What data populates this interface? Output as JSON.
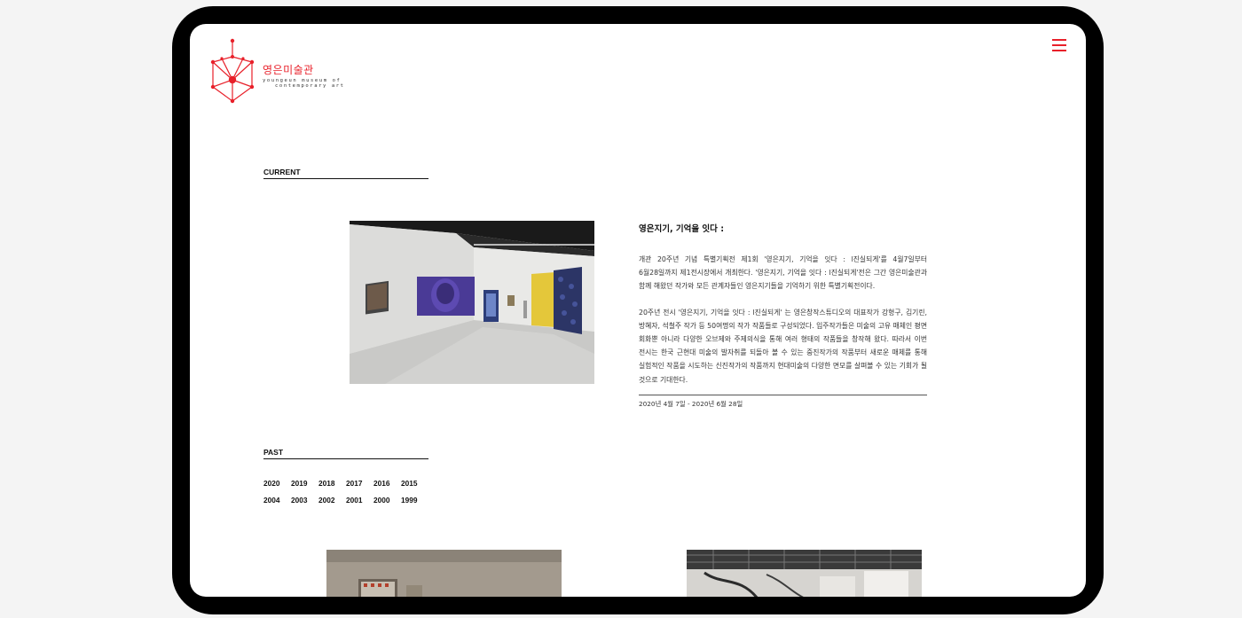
{
  "brand": {
    "name_kr": "영은미술관",
    "name_en_line1": "youngeun museum of",
    "name_en_line2": "contemporary art",
    "accent_color": "#e8202a"
  },
  "header": {
    "menu_icon": "hamburger-menu-icon"
  },
  "current": {
    "label": "CURRENT",
    "exhibition": {
      "title": "영은지기, 기억을 잇다 :",
      "paragraph1": "개관 20주년 기념 특별기획전 제1회 '영은지기, 기억을 잇다 : l진실되게'를 4월7일부터 6월28일까지 제1전시장에서 개최한다. '영은지기, 기억을 잇다 : l진실되게'전은 그간 영은미술관과 함께 해왔던 작가와 모든 관계자들인 영은지기들을 기억하기 위한 특별기획전이다.",
      "paragraph2": "20주년 전시 '영은지기, 기억을 잇다 : l진실되게' 는 영은창작스튜디오의 대표작가 강형구, 김기린, 방혜자, 석철주 작가 등 50여명의 작가 작품들로 구성되었다. 입주작가들은 미술의 고유 매체인 평면 회화뿐 아니라 다양한 오브제와 주제의식을 통해 여러 형태의 작품들을 창작해 왔다. 따라서 이번 전시는 한국 근현대 미술의 발자취를 되돌아 볼 수 있는 중진작가의 작품부터 새로운 매체를 통해 실험적인 작품을 시도하는 신진작가의 작품까지 현대미술의 다양한 면모를 살펴볼 수 있는 기회가 될 것으로 기대한다.",
      "date": "2020년 4월 7일 - 2020년 6월 28일"
    }
  },
  "past": {
    "label": "PAST",
    "years_row1": [
      "2020",
      "2019",
      "2018",
      "2017",
      "2016",
      "2015"
    ],
    "years_row2": [
      "2004",
      "2003",
      "2002",
      "2001",
      "2000",
      "1999"
    ]
  }
}
